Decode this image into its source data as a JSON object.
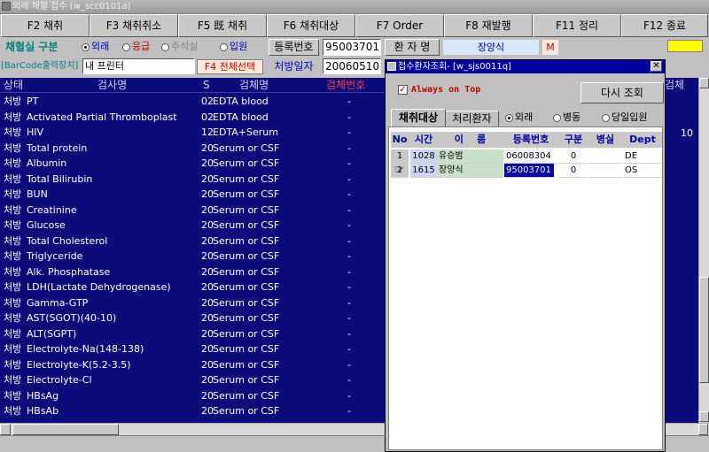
{
  "window": {
    "title": "외래 채혈 접수 (w_scc0101a)"
  },
  "toolbar": [
    {
      "label": "F2 채취"
    },
    {
      "label": "F3 채취취소"
    },
    {
      "label": "F5 既 채취"
    },
    {
      "label": "F6 채취대상"
    },
    {
      "label": "F7 Order"
    },
    {
      "label": "F8 재발행"
    },
    {
      "label": "F11 정리"
    },
    {
      "label": "F12 종료"
    }
  ],
  "form": {
    "section_label": "채혈실 구분",
    "radios": [
      {
        "label": "외래",
        "selected": true,
        "color": "#0000c0"
      },
      {
        "label": "응급",
        "selected": false,
        "color": "#c00000"
      },
      {
        "label": "주석실",
        "selected": false,
        "color": "#808080"
      },
      {
        "label": "입원",
        "selected": false,
        "color": "#0000c0"
      }
    ],
    "reg_label": "등록번호",
    "reg_value": "95003701",
    "patient_label": "환 자 명",
    "patient_value": "장양식",
    "gender": "M",
    "barcode_label": "[BarCode출력장치]",
    "printer_value": "내 프린터",
    "select_all": "F4 전체선택",
    "presc_label": "처방일자",
    "presc_value": "20060510"
  },
  "grid": {
    "headers": {
      "status": "상태",
      "test": "검사명",
      "s": "S",
      "specimen": "검체명",
      "specimen_no": "검체번호",
      "extra": "검체"
    },
    "rows": [
      {
        "status": "처방",
        "test": "PT",
        "s": "02",
        "specimen": "EDTA blood",
        "no": "-"
      },
      {
        "status": "처방",
        "test": "Activated Partial Thromboplast",
        "s": "02",
        "specimen": "EDTA blood",
        "no": "-"
      },
      {
        "status": "처방",
        "test": "HIV",
        "s": "12",
        "specimen": "EDTA+Serum",
        "no": "-"
      },
      {
        "status": "처방",
        "test": "Total  protein",
        "s": "20",
        "specimen": "Serum or CSF",
        "no": "-"
      },
      {
        "status": "처방",
        "test": "Albumin",
        "s": "20",
        "specimen": "Serum or CSF",
        "no": "-"
      },
      {
        "status": "처방",
        "test": "Total Bilirubin",
        "s": "20",
        "specimen": "Serum or CSF",
        "no": "-"
      },
      {
        "status": "처방",
        "test": "BUN",
        "s": "20",
        "specimen": "Serum or CSF",
        "no": "-"
      },
      {
        "status": "처방",
        "test": "Creatinine",
        "s": "20",
        "specimen": "Serum or CSF",
        "no": "-"
      },
      {
        "status": "처방",
        "test": "Glucose",
        "s": "20",
        "specimen": "Serum or CSF",
        "no": "-"
      },
      {
        "status": "처방",
        "test": "Total Cholesterol",
        "s": "20",
        "specimen": "Serum or CSF",
        "no": "-"
      },
      {
        "status": "처방",
        "test": "Triglyceride",
        "s": "20",
        "specimen": "Serum or CSF",
        "no": "-"
      },
      {
        "status": "처방",
        "test": "Alk. Phosphatase",
        "s": "20",
        "specimen": "Serum or CSF",
        "no": "-"
      },
      {
        "status": "처방",
        "test": "LDH(Lactate Dehydrogenase)",
        "s": "20",
        "specimen": "Serum or CSF",
        "no": "-"
      },
      {
        "status": "처방",
        "test": "Gamma-GTP",
        "s": "20",
        "specimen": "Serum or CSF",
        "no": "-"
      },
      {
        "status": "처방",
        "test": "AST(SGOT)(40-10)",
        "s": "20",
        "specimen": "Serum or CSF",
        "no": "-"
      },
      {
        "status": "처방",
        "test": "ALT(SGPT)",
        "s": "20",
        "specimen": "Serum or CSF",
        "no": "-"
      },
      {
        "status": "처방",
        "test": "Electrolyte-Na(148-138)",
        "s": "20",
        "specimen": "Serum or CSF",
        "no": "-"
      },
      {
        "status": "처방",
        "test": "Electrolyte-K(5.2-3.5)",
        "s": "20",
        "specimen": "Serum or CSF",
        "no": "-"
      },
      {
        "status": "처방",
        "test": "Electrolyte-Cl",
        "s": "20",
        "specimen": "Serum or CSF",
        "no": "-"
      },
      {
        "status": "처방",
        "test": "HBsAg",
        "s": "20",
        "specimen": "Serum or CSF",
        "no": "-"
      },
      {
        "status": "처방",
        "test": "HBsAb",
        "s": "20",
        "specimen": "Serum or CSF",
        "no": "-"
      }
    ],
    "right_value": "10"
  },
  "popup": {
    "title": "접수환자조회- [w_sjs0011q]",
    "always_on_top": "Always on Top",
    "refresh": "다시 조회",
    "tabs": [
      {
        "label": "채취대상",
        "active": true
      },
      {
        "label": "처리환자",
        "active": false
      }
    ],
    "radios": [
      {
        "label": "외래",
        "selected": true
      },
      {
        "label": "병동",
        "selected": false
      },
      {
        "label": "당일입원",
        "selected": false
      }
    ],
    "headers": {
      "no": "No",
      "time": "시간",
      "name": "이    름",
      "reg": "등록번호",
      "type": "구분",
      "room": "병실",
      "dept": "Dept"
    },
    "rows": [
      {
        "no": "1",
        "time": "1028",
        "name": "유승범",
        "reg": "06008304",
        "type": "0",
        "room": "",
        "dept": "DE"
      },
      {
        "no": "2",
        "time": "1615",
        "name": "장양식",
        "reg": "95003701",
        "type": "0",
        "room": "",
        "dept": "OS"
      }
    ]
  }
}
